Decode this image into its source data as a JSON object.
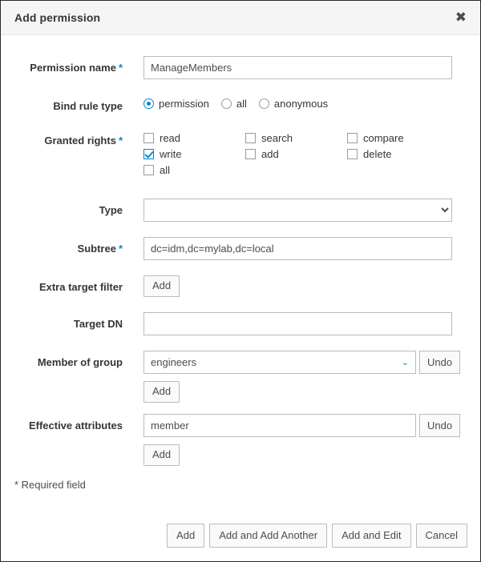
{
  "dialog": {
    "title": "Add permission",
    "close_icon": "close-icon",
    "close_glyph": "✖"
  },
  "fields": {
    "permission_name": {
      "label": "Permission name",
      "required_marker": "*",
      "value": "ManageMembers",
      "placeholder": ""
    },
    "bind_rule_type": {
      "label": "Bind rule type",
      "options": [
        {
          "label": "permission",
          "selected": true
        },
        {
          "label": "all",
          "selected": false
        },
        {
          "label": "anonymous",
          "selected": false
        }
      ]
    },
    "granted_rights": {
      "label": "Granted rights",
      "required_marker": "*",
      "rows": [
        [
          {
            "label": "read",
            "checked": false
          },
          {
            "label": "search",
            "checked": false
          },
          {
            "label": "compare",
            "checked": false
          }
        ],
        [
          {
            "label": "write",
            "checked": true
          },
          {
            "label": "add",
            "checked": false
          },
          {
            "label": "delete",
            "checked": false
          }
        ],
        [
          {
            "label": "all",
            "checked": false
          }
        ]
      ]
    },
    "type": {
      "label": "Type",
      "selected": "",
      "options": [
        ""
      ]
    },
    "subtree": {
      "label": "Subtree",
      "required_marker": "*",
      "value": "dc=idm,dc=mylab,dc=local",
      "placeholder": ""
    },
    "extra_target_filter": {
      "label": "Extra target filter",
      "add_label": "Add"
    },
    "target_dn": {
      "label": "Target DN",
      "value": "",
      "placeholder": ""
    },
    "member_of_group": {
      "label": "Member of group",
      "value": "engineers",
      "chevron_glyph": "⌄",
      "undo_label": "Undo",
      "add_label": "Add"
    },
    "effective_attributes": {
      "label": "Effective attributes",
      "value": "member",
      "placeholder": "",
      "undo_label": "Undo",
      "add_label": "Add"
    }
  },
  "required_note": "* Required field",
  "footer": {
    "buttons": [
      {
        "label": "Add"
      },
      {
        "label": "Add and Add Another"
      },
      {
        "label": "Add and Edit"
      },
      {
        "label": "Cancel"
      }
    ]
  },
  "colors": {
    "accent": "#0088ce",
    "header_bg": "#f5f5f5",
    "border": "#292929",
    "field_border": "#bbbbbb",
    "text": "#363636"
  }
}
